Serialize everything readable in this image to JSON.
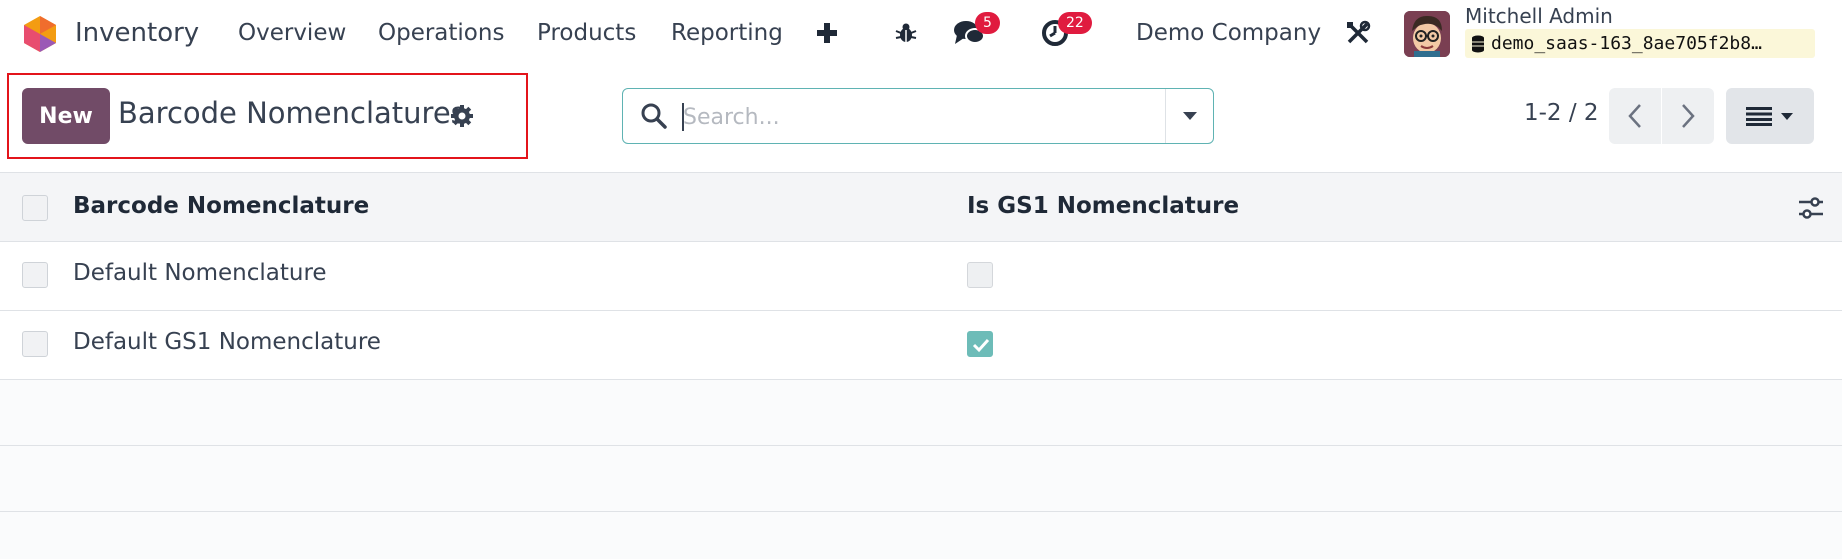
{
  "navbar": {
    "app_name": "Inventory",
    "menu": [
      "Overview",
      "Operations",
      "Products",
      "Reporting"
    ],
    "messages_count": "5",
    "activities_count": "22",
    "company": "Demo Company",
    "user_name": "Mitchell Admin",
    "database": "demo_saas-163_8ae705f2b8…"
  },
  "control_panel": {
    "new_label": "New",
    "title": "Barcode Nomenclatures",
    "search_placeholder": "Search...",
    "pager": "1-2 / 2"
  },
  "table": {
    "columns": [
      "Barcode Nomenclature",
      "Is GS1 Nomenclature"
    ],
    "rows": [
      {
        "name": "Default Nomenclature",
        "is_gs1": false
      },
      {
        "name": "Default GS1 Nomenclature",
        "is_gs1": true
      }
    ]
  },
  "colors": {
    "brand": "#714b67",
    "accent": "#6dbcb8",
    "badge": "#e01b3f",
    "highlight": "#e3141b"
  }
}
